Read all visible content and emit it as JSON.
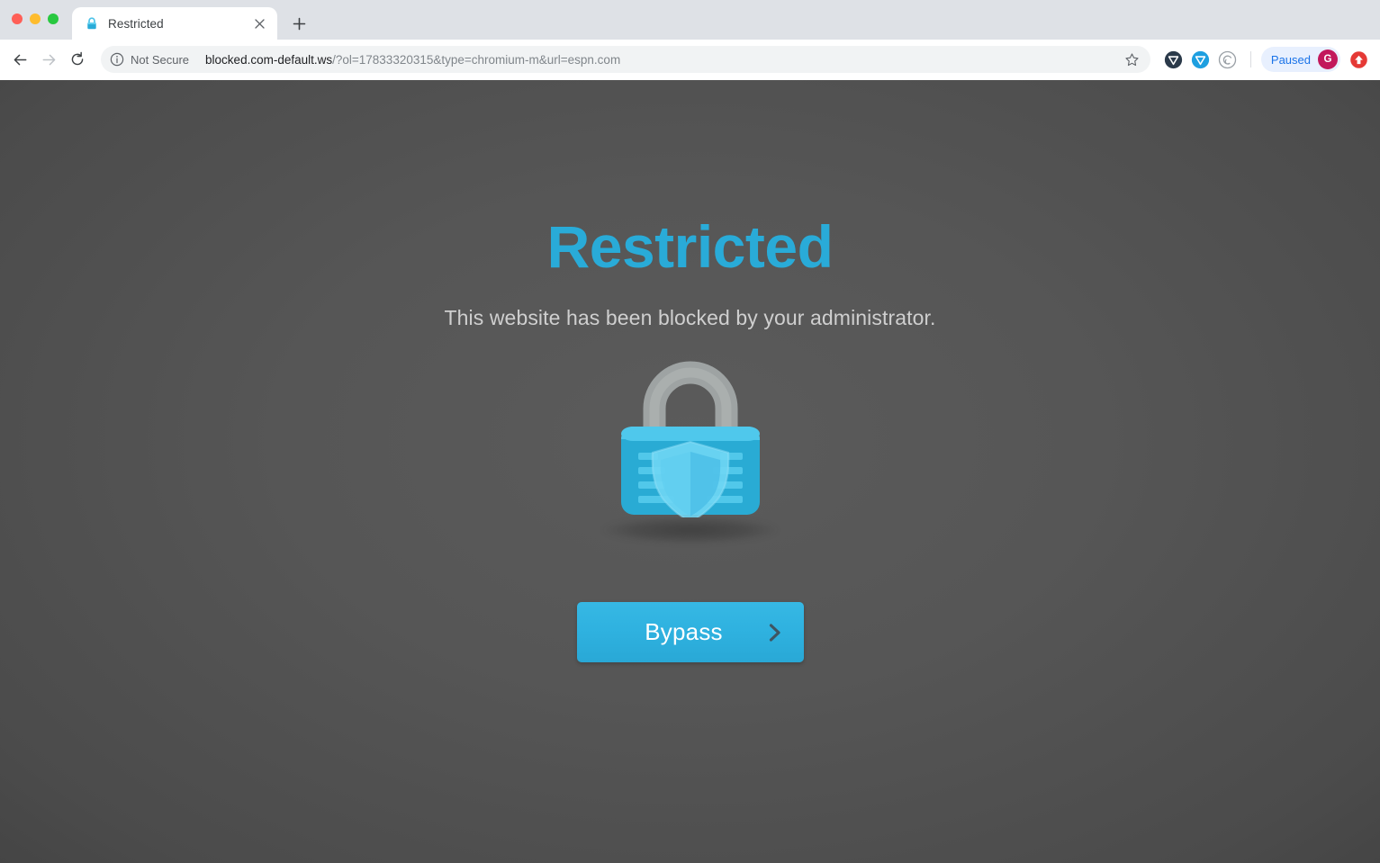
{
  "window": {
    "controls": [
      {
        "name": "close",
        "color": "#ff5f57"
      },
      {
        "name": "minimize",
        "color": "#febc2e"
      },
      {
        "name": "zoom",
        "color": "#28c840"
      }
    ]
  },
  "tabstrip": {
    "tab": {
      "title": "Restricted",
      "favicon": "padlock-icon",
      "close_label": "×"
    },
    "new_tab_label": "+"
  },
  "toolbar": {
    "back_label": "←",
    "forward_label": "→",
    "reload_label": "⟳",
    "security": {
      "icon": "info-circle-icon",
      "label": "Not Secure"
    },
    "url": {
      "host": "blocked.com-default.ws",
      "rest": "/?ol=17833320315&type=chromium-m&url=espn.com",
      "full": "blocked.com-default.ws/?ol=17833320315&type=chromium-m&url=espn.com"
    },
    "bookmark_star": "star-icon",
    "extensions": [
      {
        "name": "shield-dark-extension-icon",
        "color": "#2b3a4a"
      },
      {
        "name": "shield-blue-extension-icon",
        "color": "#1e9fe0"
      },
      {
        "name": "spiral-extension-icon",
        "color": "#9aa0a6"
      }
    ],
    "profile": {
      "status_label": "Paused",
      "avatar_initial": "G",
      "avatar_color": "#c2185b",
      "pill_color": "#e8f0fe",
      "status_text_color": "#1a73e8"
    },
    "update": {
      "name": "update-arrow-icon",
      "color": "#e53935"
    }
  },
  "page": {
    "headline": "Restricted",
    "headline_color": "#29abd8",
    "subtitle": "This website has been blocked by your administrator.",
    "subtitle_color": "#cfcfcf",
    "illustration": {
      "name": "padlock-shield-illustration",
      "shackle_color": "#9ea3a3",
      "body_color": "#29abd4",
      "body_top_color": "#4fc8ec",
      "shield_color": "#5fcff0"
    },
    "cta": {
      "label": "Bypass",
      "chevron": "›",
      "bg_color": "#2fb2e0",
      "text_color": "#ffffff"
    },
    "background": {
      "center_color": "#585858",
      "edge_color": "#313131"
    }
  }
}
